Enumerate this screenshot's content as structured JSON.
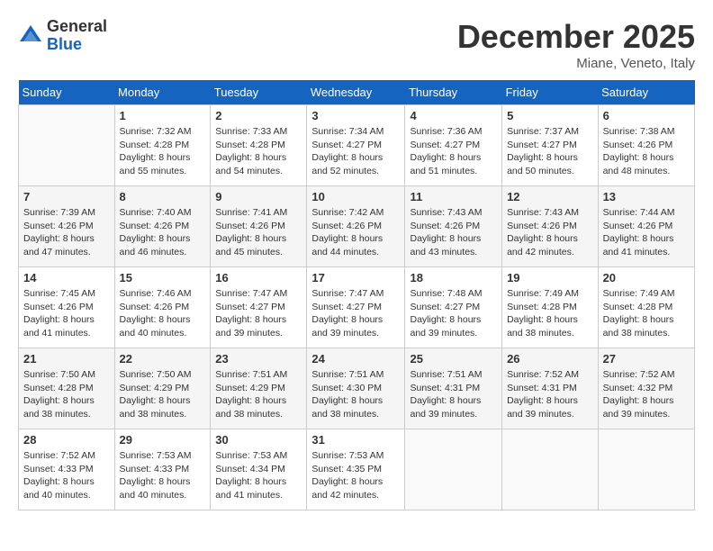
{
  "header": {
    "logo_general": "General",
    "logo_blue": "Blue",
    "month_title": "December 2025",
    "location": "Miane, Veneto, Italy"
  },
  "days_of_week": [
    "Sunday",
    "Monday",
    "Tuesday",
    "Wednesday",
    "Thursday",
    "Friday",
    "Saturday"
  ],
  "weeks": [
    [
      {
        "day": "",
        "info": ""
      },
      {
        "day": "1",
        "info": "Sunrise: 7:32 AM\nSunset: 4:28 PM\nDaylight: 8 hours\nand 55 minutes."
      },
      {
        "day": "2",
        "info": "Sunrise: 7:33 AM\nSunset: 4:28 PM\nDaylight: 8 hours\nand 54 minutes."
      },
      {
        "day": "3",
        "info": "Sunrise: 7:34 AM\nSunset: 4:27 PM\nDaylight: 8 hours\nand 52 minutes."
      },
      {
        "day": "4",
        "info": "Sunrise: 7:36 AM\nSunset: 4:27 PM\nDaylight: 8 hours\nand 51 minutes."
      },
      {
        "day": "5",
        "info": "Sunrise: 7:37 AM\nSunset: 4:27 PM\nDaylight: 8 hours\nand 50 minutes."
      },
      {
        "day": "6",
        "info": "Sunrise: 7:38 AM\nSunset: 4:26 PM\nDaylight: 8 hours\nand 48 minutes."
      }
    ],
    [
      {
        "day": "7",
        "info": "Sunrise: 7:39 AM\nSunset: 4:26 PM\nDaylight: 8 hours\nand 47 minutes."
      },
      {
        "day": "8",
        "info": "Sunrise: 7:40 AM\nSunset: 4:26 PM\nDaylight: 8 hours\nand 46 minutes."
      },
      {
        "day": "9",
        "info": "Sunrise: 7:41 AM\nSunset: 4:26 PM\nDaylight: 8 hours\nand 45 minutes."
      },
      {
        "day": "10",
        "info": "Sunrise: 7:42 AM\nSunset: 4:26 PM\nDaylight: 8 hours\nand 44 minutes."
      },
      {
        "day": "11",
        "info": "Sunrise: 7:43 AM\nSunset: 4:26 PM\nDaylight: 8 hours\nand 43 minutes."
      },
      {
        "day": "12",
        "info": "Sunrise: 7:43 AM\nSunset: 4:26 PM\nDaylight: 8 hours\nand 42 minutes."
      },
      {
        "day": "13",
        "info": "Sunrise: 7:44 AM\nSunset: 4:26 PM\nDaylight: 8 hours\nand 41 minutes."
      }
    ],
    [
      {
        "day": "14",
        "info": "Sunrise: 7:45 AM\nSunset: 4:26 PM\nDaylight: 8 hours\nand 41 minutes."
      },
      {
        "day": "15",
        "info": "Sunrise: 7:46 AM\nSunset: 4:26 PM\nDaylight: 8 hours\nand 40 minutes."
      },
      {
        "day": "16",
        "info": "Sunrise: 7:47 AM\nSunset: 4:27 PM\nDaylight: 8 hours\nand 39 minutes."
      },
      {
        "day": "17",
        "info": "Sunrise: 7:47 AM\nSunset: 4:27 PM\nDaylight: 8 hours\nand 39 minutes."
      },
      {
        "day": "18",
        "info": "Sunrise: 7:48 AM\nSunset: 4:27 PM\nDaylight: 8 hours\nand 39 minutes."
      },
      {
        "day": "19",
        "info": "Sunrise: 7:49 AM\nSunset: 4:28 PM\nDaylight: 8 hours\nand 38 minutes."
      },
      {
        "day": "20",
        "info": "Sunrise: 7:49 AM\nSunset: 4:28 PM\nDaylight: 8 hours\nand 38 minutes."
      }
    ],
    [
      {
        "day": "21",
        "info": "Sunrise: 7:50 AM\nSunset: 4:28 PM\nDaylight: 8 hours\nand 38 minutes."
      },
      {
        "day": "22",
        "info": "Sunrise: 7:50 AM\nSunset: 4:29 PM\nDaylight: 8 hours\nand 38 minutes."
      },
      {
        "day": "23",
        "info": "Sunrise: 7:51 AM\nSunset: 4:29 PM\nDaylight: 8 hours\nand 38 minutes."
      },
      {
        "day": "24",
        "info": "Sunrise: 7:51 AM\nSunset: 4:30 PM\nDaylight: 8 hours\nand 38 minutes."
      },
      {
        "day": "25",
        "info": "Sunrise: 7:51 AM\nSunset: 4:31 PM\nDaylight: 8 hours\nand 39 minutes."
      },
      {
        "day": "26",
        "info": "Sunrise: 7:52 AM\nSunset: 4:31 PM\nDaylight: 8 hours\nand 39 minutes."
      },
      {
        "day": "27",
        "info": "Sunrise: 7:52 AM\nSunset: 4:32 PM\nDaylight: 8 hours\nand 39 minutes."
      }
    ],
    [
      {
        "day": "28",
        "info": "Sunrise: 7:52 AM\nSunset: 4:33 PM\nDaylight: 8 hours\nand 40 minutes."
      },
      {
        "day": "29",
        "info": "Sunrise: 7:53 AM\nSunset: 4:33 PM\nDaylight: 8 hours\nand 40 minutes."
      },
      {
        "day": "30",
        "info": "Sunrise: 7:53 AM\nSunset: 4:34 PM\nDaylight: 8 hours\nand 41 minutes."
      },
      {
        "day": "31",
        "info": "Sunrise: 7:53 AM\nSunset: 4:35 PM\nDaylight: 8 hours\nand 42 minutes."
      },
      {
        "day": "",
        "info": ""
      },
      {
        "day": "",
        "info": ""
      },
      {
        "day": "",
        "info": ""
      }
    ]
  ]
}
